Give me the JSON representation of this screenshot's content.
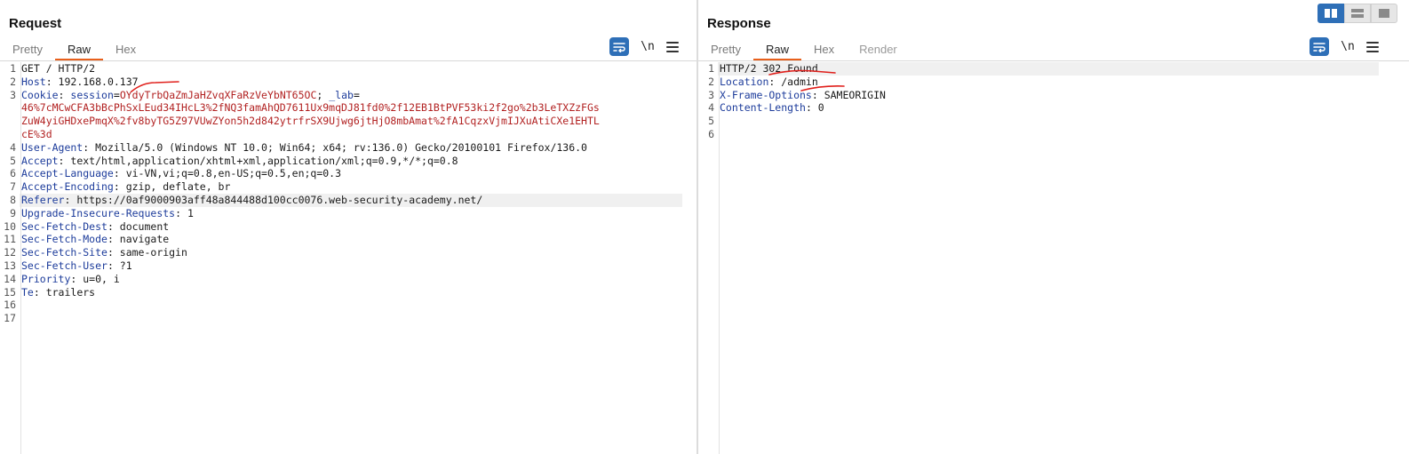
{
  "request": {
    "title": "Request",
    "tabs": [
      "Pretty",
      "Raw",
      "Hex"
    ],
    "active_tab": "Raw",
    "newline_label": "\\n",
    "lines": [
      {
        "n": "1",
        "parts": [
          {
            "t": "GET / HTTP/2",
            "c": "plain"
          }
        ]
      },
      {
        "n": "2",
        "parts": [
          {
            "t": "Host",
            "c": "hname"
          },
          {
            "t": ": 192.168.0.137",
            "c": "plain"
          }
        ]
      },
      {
        "n": "3",
        "parts": [
          {
            "t": "Cookie",
            "c": "hname"
          },
          {
            "t": ": ",
            "c": "plain"
          },
          {
            "t": "session",
            "c": "ckey"
          },
          {
            "t": "=",
            "c": "plain"
          },
          {
            "t": "OYdyTrbQaZmJaHZvqXFaRzVeYbNT65OC",
            "c": "cval"
          },
          {
            "t": "; ",
            "c": "plain"
          },
          {
            "t": "_lab",
            "c": "ckey"
          },
          {
            "t": "=",
            "c": "plain"
          }
        ]
      },
      {
        "n": "",
        "parts": [
          {
            "t": "46%7cMCwCFA3bBcPhSxLEud34IHcL3%2fNQ3famAhQD7611Ux9mqDJ81fd0%2f12EB1BtPVF53ki2f2go%2b3LeTXZzFGs",
            "c": "cval"
          }
        ]
      },
      {
        "n": "",
        "parts": [
          {
            "t": "ZuW4yiGHDxePmqX%2fv8byTG5Z97VUwZYon5h2d842ytrfrSX9Ujwg6jtHjO8mbAmat%2fA1CqzxVjmIJXuAtiCXe1EHTL",
            "c": "cval"
          }
        ]
      },
      {
        "n": "",
        "parts": [
          {
            "t": "cE%3d",
            "c": "cval"
          }
        ]
      },
      {
        "n": "4",
        "parts": [
          {
            "t": "User-Agent",
            "c": "hname"
          },
          {
            "t": ": Mozilla/5.0 (Windows NT 10.0; Win64; x64; rv:136.0) Gecko/20100101 Firefox/136.0",
            "c": "plain"
          }
        ]
      },
      {
        "n": "5",
        "parts": [
          {
            "t": "Accept",
            "c": "hname"
          },
          {
            "t": ": text/html,application/xhtml+xml,application/xml;q=0.9,*/*;q=0.8",
            "c": "plain"
          }
        ]
      },
      {
        "n": "6",
        "parts": [
          {
            "t": "Accept-Language",
            "c": "hname"
          },
          {
            "t": ": vi-VN,vi;q=0.8,en-US;q=0.5,en;q=0.3",
            "c": "plain"
          }
        ]
      },
      {
        "n": "7",
        "parts": [
          {
            "t": "Accept-Encoding",
            "c": "hname"
          },
          {
            "t": ": gzip, deflate, br",
            "c": "plain"
          }
        ]
      },
      {
        "n": "8",
        "hl": true,
        "parts": [
          {
            "t": "Referer",
            "c": "hname"
          },
          {
            "t": ": https://0af9000903aff48a844488d100cc0076.web-security-academy.net/",
            "c": "plain"
          }
        ]
      },
      {
        "n": "9",
        "parts": [
          {
            "t": "Upgrade-Insecure-Requests",
            "c": "hname"
          },
          {
            "t": ": 1",
            "c": "plain"
          }
        ]
      },
      {
        "n": "10",
        "parts": [
          {
            "t": "Sec-Fetch-Dest",
            "c": "hname"
          },
          {
            "t": ": document",
            "c": "plain"
          }
        ]
      },
      {
        "n": "11",
        "parts": [
          {
            "t": "Sec-Fetch-Mode",
            "c": "hname"
          },
          {
            "t": ": navigate",
            "c": "plain"
          }
        ]
      },
      {
        "n": "12",
        "parts": [
          {
            "t": "Sec-Fetch-Site",
            "c": "hname"
          },
          {
            "t": ": same-origin",
            "c": "plain"
          }
        ]
      },
      {
        "n": "13",
        "parts": [
          {
            "t": "Sec-Fetch-User",
            "c": "hname"
          },
          {
            "t": ": ?1",
            "c": "plain"
          }
        ]
      },
      {
        "n": "14",
        "parts": [
          {
            "t": "Priority",
            "c": "hname"
          },
          {
            "t": ": u=0, i",
            "c": "plain"
          }
        ]
      },
      {
        "n": "15",
        "parts": [
          {
            "t": "Te",
            "c": "hname"
          },
          {
            "t": ": trailers",
            "c": "plain"
          }
        ]
      },
      {
        "n": "16",
        "parts": []
      },
      {
        "n": "17",
        "parts": []
      }
    ]
  },
  "response": {
    "title": "Response",
    "tabs": [
      "Pretty",
      "Raw",
      "Hex",
      "Render"
    ],
    "active_tab": "Raw",
    "newline_label": "\\n",
    "lines": [
      {
        "n": "1",
        "hl": true,
        "parts": [
          {
            "t": "HTTP/2 302 Found",
            "c": "plain"
          }
        ]
      },
      {
        "n": "2",
        "parts": [
          {
            "t": "Location",
            "c": "hname"
          },
          {
            "t": ": /admin",
            "c": "plain"
          }
        ]
      },
      {
        "n": "3",
        "parts": [
          {
            "t": "X-Frame-Options",
            "c": "hname"
          },
          {
            "t": ": SAMEORIGIN",
            "c": "plain"
          }
        ]
      },
      {
        "n": "4",
        "parts": [
          {
            "t": "Content-Length",
            "c": "hname"
          },
          {
            "t": ": 0",
            "c": "plain"
          }
        ]
      },
      {
        "n": "5",
        "parts": []
      },
      {
        "n": "6",
        "parts": []
      }
    ]
  },
  "colors": {
    "accent_tab": "#e8601c",
    "button_blue": "#2e6fb7",
    "header_name": "#1d3c9b",
    "cookie_value": "#b22222",
    "annotation": "#e0201c"
  },
  "icons": {
    "wrap": "wrap-lines-icon",
    "menu": "hamburger-menu-icon",
    "layout": [
      "side-by-side-layout-icon",
      "stacked-layout-icon",
      "single-pane-layout-icon"
    ]
  }
}
